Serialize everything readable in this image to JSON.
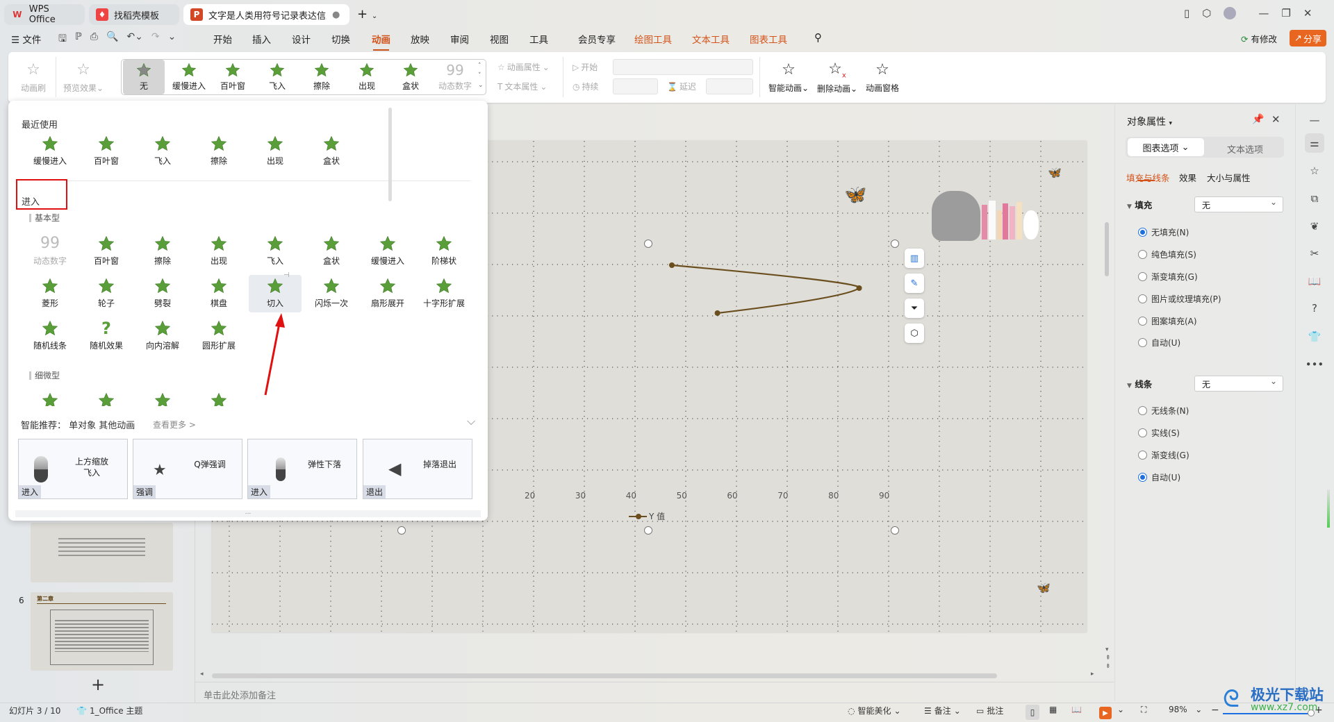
{
  "tabs": [
    {
      "label": "WPS Office",
      "icon": "wps-logo"
    },
    {
      "label": "找稻壳模板",
      "icon": "docer-logo"
    },
    {
      "label": "文字是人类用符号记录表达信息以",
      "icon": "ppt-logo",
      "active": true
    }
  ],
  "menu": {
    "file": "文件",
    "items": [
      "开始",
      "插入",
      "设计",
      "切换",
      "动画",
      "放映",
      "审阅",
      "视图",
      "工具",
      "会员专享"
    ],
    "active": "动画",
    "context_tools": [
      "绘图工具",
      "文本工具",
      "图表工具"
    ],
    "modified": "有修改",
    "share": "分享"
  },
  "ribbon": {
    "anim_brush": "动画刷",
    "preview": "预览效果",
    "gallery": [
      "无",
      "缓慢进入",
      "百叶窗",
      "飞入",
      "擦除",
      "出现",
      "盒状",
      "动态数字"
    ],
    "anim_props": "动画属性",
    "text_props": "文本属性",
    "start": "开始",
    "duration": "持续",
    "delay": "延迟",
    "smart": "智能动画",
    "delete": "删除动画",
    "pane": "动画窗格"
  },
  "panel": {
    "recent_title": "最近使用",
    "recent": [
      "缓慢进入",
      "百叶窗",
      "飞入",
      "擦除",
      "出现",
      "盒状"
    ],
    "enter_title": "进入",
    "basic_title": "基本型",
    "basic": [
      "动态数字",
      "百叶窗",
      "擦除",
      "出现",
      "飞入",
      "盒状",
      "缓慢进入",
      "阶梯状",
      "菱形",
      "轮子",
      "劈裂",
      "棋盘",
      "切入",
      "闪烁一次",
      "扇形展开",
      "十字形扩展",
      "随机线条",
      "随机效果",
      "向内溶解",
      "圆形扩展"
    ],
    "selected": "切入",
    "subtle_title": "细微型",
    "smart_label": "智能推荐：",
    "smart_scope": "单对象 其他动画",
    "see_more": "查看更多 >",
    "cards": [
      {
        "title": "上方缩放飞入",
        "tag": "进入"
      },
      {
        "title": "Q弹强调",
        "tag": "强调"
      },
      {
        "title": "弹性下落",
        "tag": "进入"
      },
      {
        "title": "掉落退出",
        "tag": "退出"
      }
    ],
    "more": "..."
  },
  "slide": {
    "notes_placeholder": "单击此处添加备注",
    "thumb_number": "6",
    "thumb_title": "第二章"
  },
  "chart_data": {
    "type": "scatter",
    "x_ticks": [
      "20",
      "30",
      "40",
      "50",
      "60",
      "70",
      "80",
      "90"
    ],
    "series": [
      {
        "name": "Y 值",
        "x": [
          48,
          85,
          57
        ],
        "smooth": true,
        "color": "#6b4e1e"
      }
    ],
    "grid": true,
    "legend": "bottom"
  },
  "right_panel": {
    "title": "对象属性",
    "tab_chart": "图表选项",
    "tab_text": "文本选项",
    "subtabs": [
      "填充与线条",
      "效果",
      "大小与属性"
    ],
    "fill": {
      "label": "填充",
      "value": "无",
      "options": [
        "无填充(N)",
        "纯色填充(S)",
        "渐变填充(G)",
        "图片或纹理填充(P)",
        "图案填充(A)",
        "自动(U)"
      ],
      "selected": 0
    },
    "line": {
      "label": "线条",
      "value": "无",
      "options": [
        "无线条(N)",
        "实线(S)",
        "渐变线(G)",
        "自动(U)"
      ],
      "selected": 3
    }
  },
  "status": {
    "slide": "幻灯片 3 / 10",
    "theme": "1_Office 主题",
    "beautify": "智能美化",
    "notes": "备注",
    "comment": "批注",
    "zoom": "98%",
    "zoom_level": 98
  },
  "watermark": {
    "name": "极光下载站",
    "url": "www.xz7.com"
  },
  "colors": {
    "accent": "#d3541b",
    "star": "#5a9e3a",
    "share": "#e8661f",
    "radio": "#1e6fe0"
  }
}
